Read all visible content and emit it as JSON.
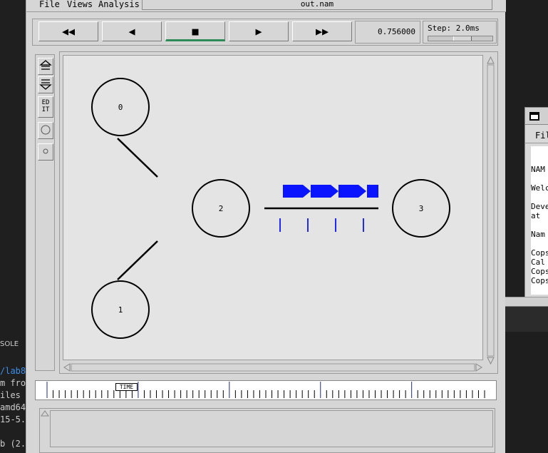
{
  "vscode": {
    "tab_label": "SOLE",
    "terminal_lines": [
      {
        "text": "/lab8",
        "link": true
      },
      {
        "text": "m fro",
        "link": false
      },
      {
        "text": "iles",
        "link": false
      },
      {
        "text": "amd64",
        "link": false
      },
      {
        "text": "15-5.",
        "link": false
      },
      {
        "text": "",
        "link": false
      },
      {
        "text": "b (2.",
        "link": false
      }
    ]
  },
  "background_window": {
    "menu_label": "Fil",
    "text_lines": [
      "NAM",
      "",
      "Welc",
      "",
      "Deve",
      "at",
      "",
      "Nam",
      "",
      "Cops",
      "Cal",
      "Cops",
      "Cops"
    ]
  },
  "nam": {
    "menu": {
      "file": "File",
      "views": "Views",
      "analysis": "Analysis"
    },
    "filename": "out.nam",
    "controls": {
      "rewind": "◀◀",
      "back": "◀",
      "stop": "■",
      "play": "▶",
      "fastforward": "▶▶"
    },
    "time_value": "0.756000",
    "step_label": "Step: 2.0ms",
    "step_slider_fraction": 0.55,
    "toolbar": {
      "edit_label_line1": "ED",
      "edit_label_line2": "IT"
    },
    "nodes": [
      {
        "id": "0",
        "label": "0",
        "x": 0,
        "y": 0
      },
      {
        "id": "1",
        "label": "1",
        "x": 0,
        "y": 2
      },
      {
        "id": "2",
        "label": "2",
        "x": 1,
        "y": 1
      },
      {
        "id": "3",
        "label": "3",
        "x": 2,
        "y": 1
      }
    ],
    "links": [
      {
        "from": "0",
        "to": "2"
      },
      {
        "from": "1",
        "to": "2"
      },
      {
        "from": "2",
        "to": "3"
      }
    ],
    "packets": {
      "count": 4,
      "color": "#0a14ff"
    },
    "timeline": {
      "marker_label": "TIME",
      "marker_position": 0.18
    }
  },
  "colors": {
    "packet": "#0a14ff",
    "play_indicator": "#2e8b57",
    "canvas_bg": "#e4e4e4",
    "window_bg": "#d6d6d6"
  }
}
